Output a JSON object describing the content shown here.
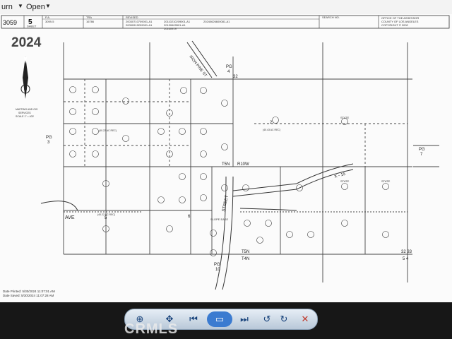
{
  "menubar": {
    "item_1": "urn",
    "item_2": "Open"
  },
  "header": {
    "map_book": "3059",
    "page": "5",
    "sheet_label": "SHEET",
    "pa_label": "P.A.",
    "pa_value": "3059-5",
    "tra_label": "TRA",
    "tra_value": "16786",
    "revised_label": "REVISED",
    "revised_1": "20030710709001-A1",
    "revised_2": "20050919209001-A1",
    "revised_3": "20110210209001-A1",
    "revised_4": "20130609501-A1",
    "revised_5": "20160919",
    "revised_6": "20240626600081-A1",
    "search_label": "SEARCH NO.",
    "office_line1": "OFFICE OF THE ASSESSOR",
    "office_line2": "COUNTY OF LOS ANGELES",
    "office_line3": "COPYRIGHT © 2002"
  },
  "map": {
    "year": "2024",
    "north_caption_1": "MAPPING AND GIS",
    "north_caption_2": "SERVICES",
    "north_caption_3": "SCALE 1\" = 400'",
    "street_1": "IRON PINE ST",
    "street_2": "STREET",
    "street_3": "AVE",
    "road_x15": "X - 15",
    "slope_label": "SLOPE EASE",
    "pg_4": "PG\n4",
    "pg_3": "PG\n3",
    "pg_7": "PG\n7",
    "pg_10": "PG\n10",
    "section_32": "32",
    "township_1": "T5N",
    "range_1": "R10W",
    "township_2": "T5N",
    "township_3": "T4N",
    "state_1": "STATE",
    "state_2": "STATE",
    "state_3": "STATE",
    "corner_1": "32 33",
    "corner_2": "5 4",
    "lot_2": "2",
    "lot_5": "5",
    "lot_6": "6",
    "acres_1": "(40.43 AC REC)",
    "acres_2": "(40.22 AC REC)",
    "acres_3": "(40.22 AC REC)"
  },
  "footer": {
    "date_printed": "Date Printed: 5/30/2024 11:07:01 AM",
    "date_saved": "Date Saved: 5/30/2024 11:07:28 AM"
  },
  "toolbar": {
    "zoom": "zoom-icon",
    "fit": "fit-page-icon",
    "first": "first-page-icon",
    "prev": "prev-page-icon",
    "current": "page-view-icon",
    "next": "next-page-icon",
    "last": "last-page-icon",
    "rotate_ccw": "rotate-ccw-icon",
    "rotate_cw": "rotate-cw-icon",
    "close": "close-icon"
  },
  "watermark": "CRMLS"
}
